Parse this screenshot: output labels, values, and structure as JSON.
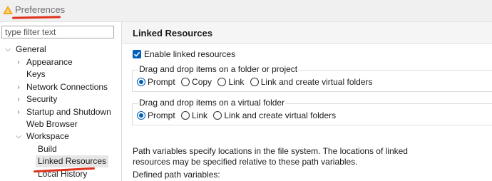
{
  "window": {
    "title": "Preferences",
    "accent": "#e0311d"
  },
  "sidebar": {
    "filter_placeholder": "type filter text",
    "items": [
      {
        "label": "General",
        "expanded": true
      },
      {
        "label": "Appearance",
        "expanded": false
      },
      {
        "label": "Keys"
      },
      {
        "label": "Network Connections",
        "expanded": false
      },
      {
        "label": "Security",
        "expanded": false
      },
      {
        "label": "Startup and Shutdown",
        "expanded": false
      },
      {
        "label": "Web Browser"
      },
      {
        "label": "Workspace",
        "expanded": true
      },
      {
        "label": "Build"
      },
      {
        "label": "Linked Resources",
        "selected": true
      },
      {
        "label": "Local History"
      }
    ]
  },
  "page": {
    "title": "Linked Resources",
    "enable_label": "Enable linked resources",
    "enable_checked": true,
    "group_folder": {
      "title": "Drag and drop items on a folder or project",
      "options": [
        "Prompt",
        "Copy",
        "Link",
        "Link and create virtual folders"
      ],
      "selected": "Prompt"
    },
    "group_virtual": {
      "title": "Drag and drop items on a virtual folder",
      "options": [
        "Prompt",
        "Link",
        "Link and create virtual folders"
      ],
      "selected": "Prompt"
    },
    "description": "Path variables specify locations in the file system. The locations of linked resources may be specified relative to these path variables.",
    "defined_label": "Defined path variables:"
  },
  "icons": {
    "app": "eclipse-triangle-icon",
    "expanded": "chevron-down-icon",
    "collapsed": "chevron-right-icon",
    "check": "checkmark-icon"
  },
  "colors": {
    "checkbox": "#005fb8",
    "selection": "#e6e6e6",
    "annotation": "#e0311d"
  }
}
